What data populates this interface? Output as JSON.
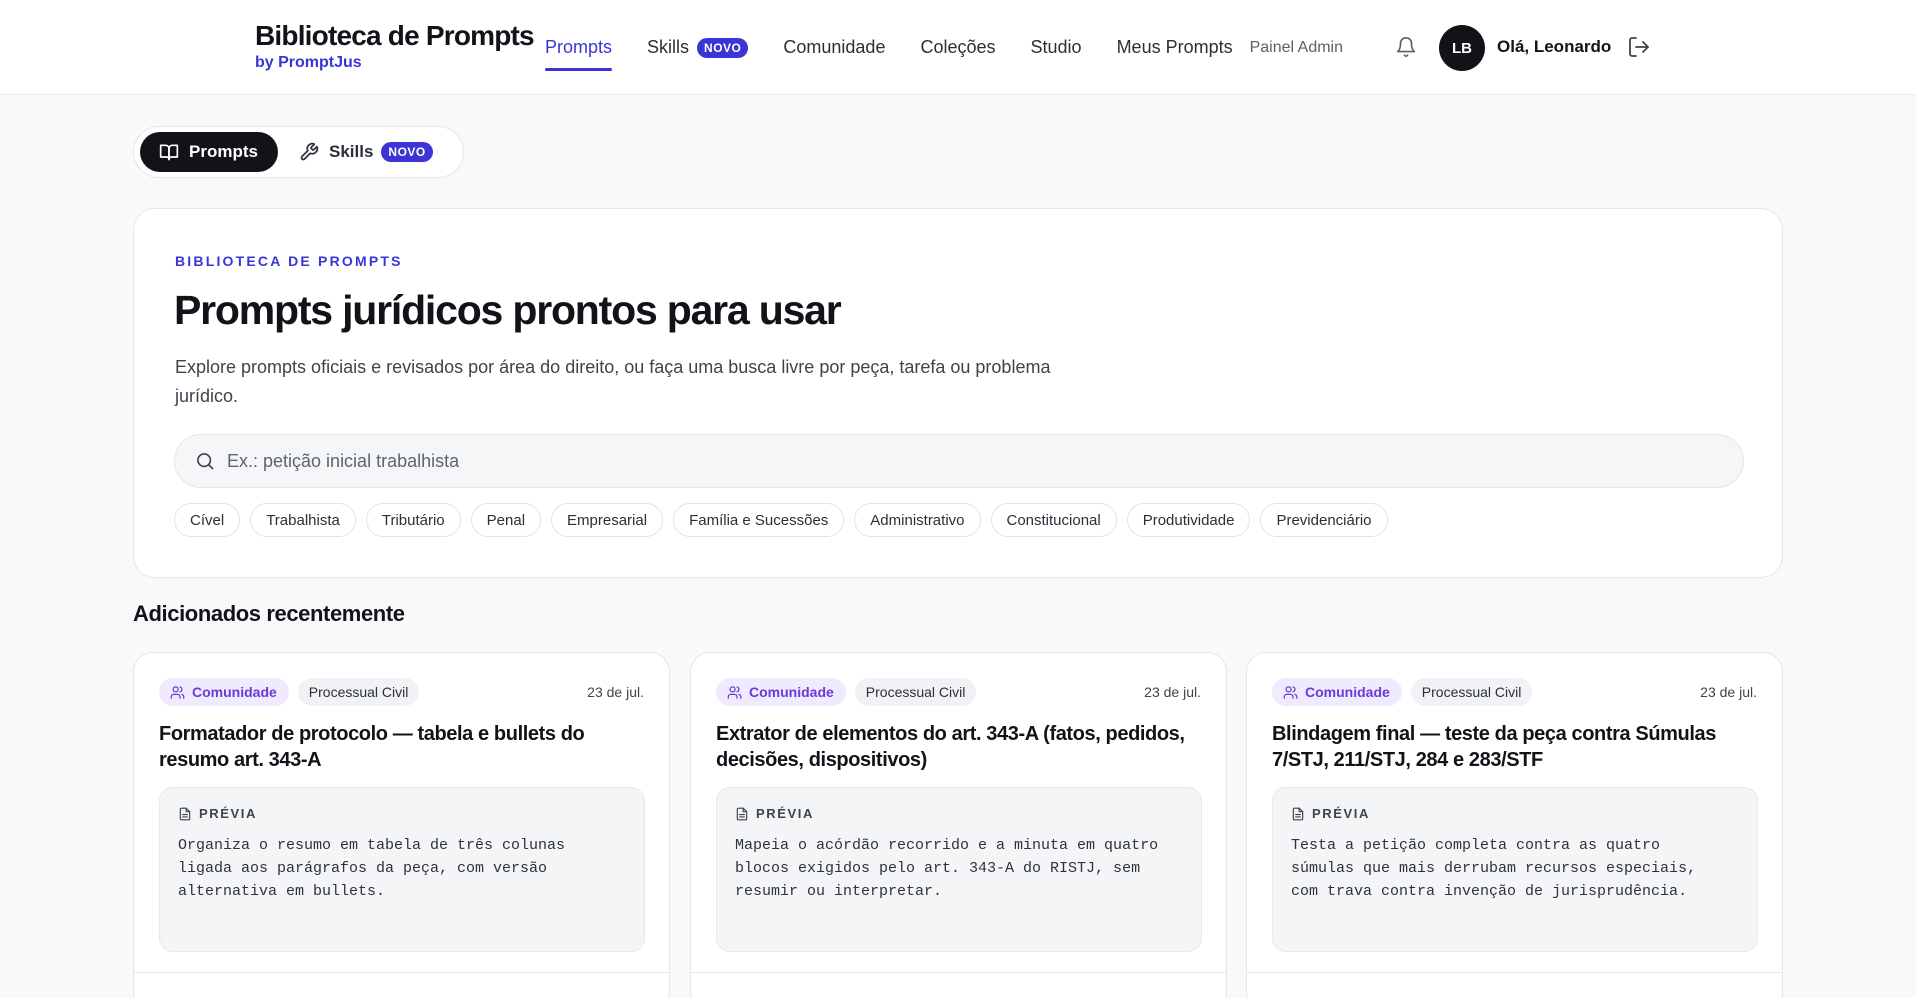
{
  "header": {
    "brand_title": "Biblioteca de Prompts",
    "brand_sub": "by PromptJus",
    "nav": [
      {
        "label": "Prompts",
        "active": true
      },
      {
        "label": "Skills",
        "badge": "NOVO"
      },
      {
        "label": "Comunidade"
      },
      {
        "label": "Coleções"
      },
      {
        "label": "Studio"
      },
      {
        "label": "Meus Prompts"
      },
      {
        "label": "Painel Admin"
      }
    ],
    "avatar_initials": "LB",
    "greeting": "Olá, Leonardo",
    "icons": [
      "bell-icon",
      "logout-icon"
    ]
  },
  "segmented": {
    "prompts_label": "Prompts",
    "skills_label": "Skills",
    "skills_badge": "NOVO"
  },
  "hero": {
    "eyebrow": "BIBLIOTECA DE PROMPTS",
    "title": "Prompts jurídicos prontos para usar",
    "description": "Explore prompts oficiais e revisados por área do direito, ou faça uma busca livre por peça, tarefa ou problema jurídico.",
    "search_placeholder": "Ex.: petição inicial trabalhista",
    "search_value": "",
    "chips": [
      "Cível",
      "Trabalhista",
      "Tributário",
      "Penal",
      "Empresarial",
      "Família e Sucessões",
      "Administrativo",
      "Constitucional",
      "Produtividade",
      "Previdenciário"
    ]
  },
  "recent": {
    "title": "Adicionados recentemente",
    "preview_label": "PRÉVIA",
    "cards": [
      {
        "tag": "Comunidade",
        "area": "Processual Civil",
        "date": "23 de jul.",
        "title": "Formatador de protocolo — tabela e bullets do resumo art. 343-A",
        "preview": "Organiza o resumo em tabela de três colunas ligada aos parágrafos da peça, com versão alternativa em bullets."
      },
      {
        "tag": "Comunidade",
        "area": "Processual Civil",
        "date": "23 de jul.",
        "title": "Extrator de elementos do art. 343-A (fatos, pedidos, decisões, dispositivos)",
        "preview": "Mapeia o acórdão recorrido e a minuta em quatro blocos exigidos pelo art. 343-A do RISTJ, sem resumir ou interpretar."
      },
      {
        "tag": "Comunidade",
        "area": "Processual Civil",
        "date": "23 de jul.",
        "title": "Blindagem final — teste da peça contra Súmulas 7/STJ, 211/STJ, 284 e 283/STF",
        "preview": "Testa a petição completa contra as quatro súmulas que mais derrubam recursos especiais, com trava contra invenção de jurisprudência."
      }
    ]
  },
  "colors": {
    "accent": "#3b35d6",
    "community": "#6b3bd6",
    "dark": "#111318"
  }
}
